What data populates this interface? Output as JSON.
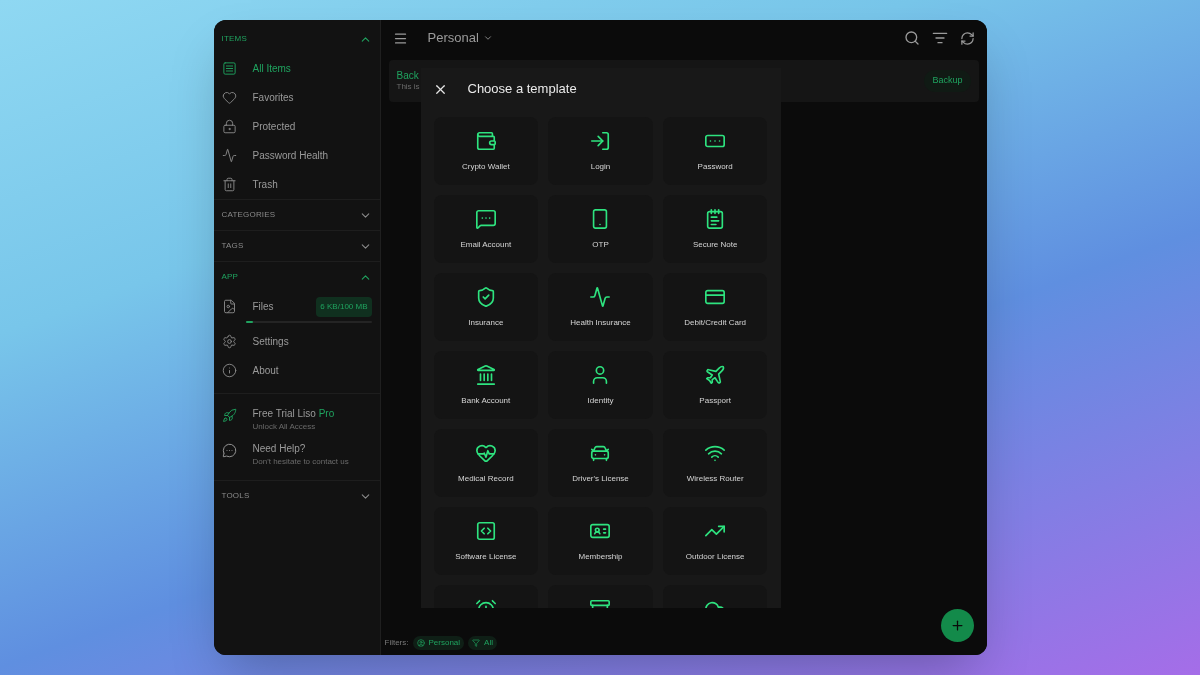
{
  "sidebar": {
    "sections": [
      {
        "title": "ITEMS",
        "expanded": true,
        "items": [
          {
            "label": "All Items",
            "selected": true
          },
          {
            "label": "Favorites",
            "selected": false
          },
          {
            "label": "Protected",
            "selected": false
          },
          {
            "label": "Password Health",
            "selected": false
          },
          {
            "label": "Trash",
            "selected": false
          }
        ]
      },
      {
        "title": "CATEGORIES",
        "expanded": false
      },
      {
        "title": "TAGS",
        "expanded": false
      },
      {
        "title": "APP",
        "expanded": true,
        "items": [
          {
            "label": "Files",
            "selected": false,
            "badge": "6 KB/100 MB",
            "level": 0.06
          },
          {
            "label": "Settings",
            "selected": false
          },
          {
            "label": "About",
            "selected": false
          }
        ]
      }
    ],
    "promos": [
      {
        "title": "Free Trial Liso",
        "highlight": "Pro",
        "subtitle": "Unlock All Access"
      },
      {
        "title": "Need Help?",
        "subtitle": "Don't hesitate to contact us"
      }
    ],
    "footer_section": {
      "title": "TOOLS",
      "expanded": false
    }
  },
  "toolbar": {
    "vault": "Personal"
  },
  "banner": {
    "title": "Back",
    "text": "This is",
    "button": "Backup"
  },
  "dialog": {
    "title": "Choose a template",
    "templates": [
      {
        "kind": "labeled",
        "label": "Crypto Wallet"
      },
      {
        "kind": "labeled",
        "label": "Login"
      },
      {
        "kind": "labeled",
        "label": "Password"
      },
      {
        "kind": "labeled",
        "label": "Email Account"
      },
      {
        "kind": "labeled",
        "label": "OTP"
      },
      {
        "kind": "labeled",
        "label": "Secure Note"
      },
      {
        "kind": "labeled",
        "label": "Insurance"
      },
      {
        "kind": "labeled",
        "label": "Health Insurance"
      },
      {
        "kind": "labeled",
        "label": "Debit/Credit Card"
      },
      {
        "kind": "labeled",
        "label": "Bank Account"
      },
      {
        "kind": "labeled",
        "label": "Identity"
      },
      {
        "kind": "labeled",
        "label": "Passport"
      },
      {
        "kind": "labeled",
        "label": "Medical Record"
      },
      {
        "kind": "labeled",
        "label": "Driver's License"
      },
      {
        "kind": "labeled",
        "label": "Wireless Router"
      },
      {
        "kind": "labeled",
        "label": "Software License"
      },
      {
        "kind": "labeled",
        "label": "Membership"
      },
      {
        "kind": "labeled",
        "label": "Outdoor License"
      },
      {
        "kind": "partial"
      },
      {
        "kind": "partial"
      },
      {
        "kind": "partial"
      }
    ]
  },
  "filters": {
    "label": "Filters:",
    "chips": [
      "Personal",
      "All"
    ]
  }
}
